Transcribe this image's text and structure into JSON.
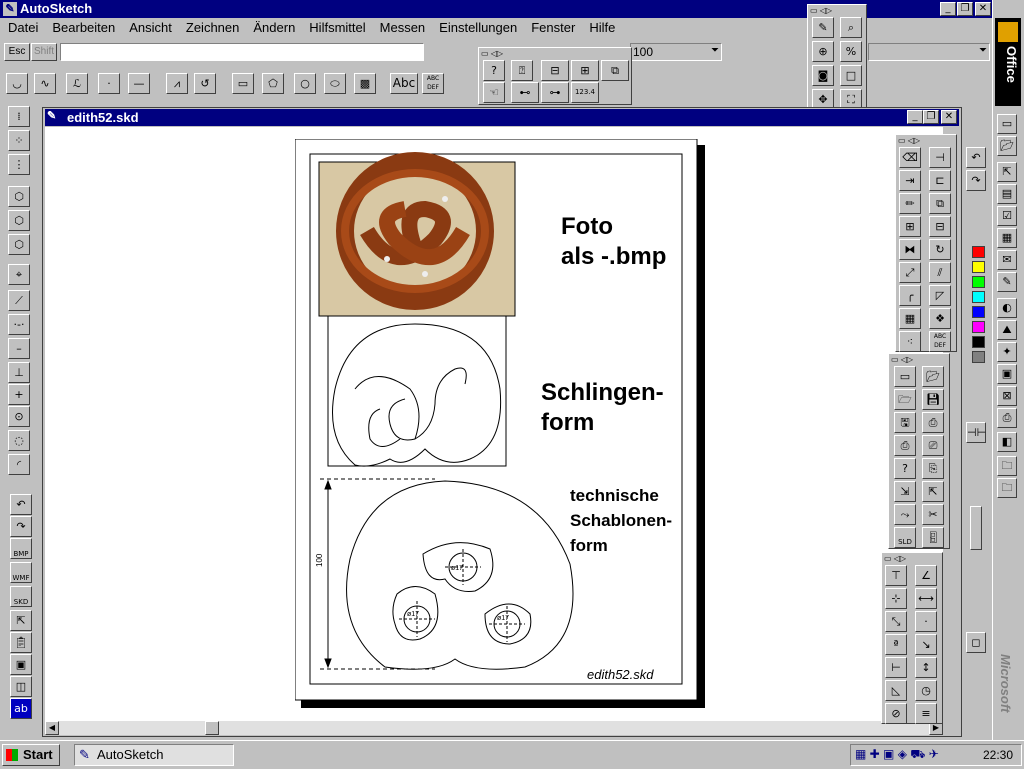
{
  "app": {
    "title": "AutoSketch"
  },
  "menu": [
    "Datei",
    "Bearbeiten",
    "Ansicht",
    "Zeichnen",
    "Ändern",
    "Hilfsmittel",
    "Messen",
    "Einstellungen",
    "Fenster",
    "Hilfe"
  ],
  "toolbar": {
    "esc": "Esc",
    "shift": "Shift",
    "zoom": "100",
    "text_abc": "Abc",
    "abcdef": "ABC DEF"
  },
  "doc": {
    "title": "edith52.skd",
    "foto_line1": "Foto",
    "foto_line2": "als -.bmp",
    "schlingen_line1": "Schlingen-",
    "schlingen_line2": "form",
    "tech_line1": "technische",
    "tech_line2": "Schablonen-",
    "tech_line3": "form",
    "dim": "100",
    "circle_label": "ø17",
    "filename": "edith52.skd"
  },
  "left_toolbar": {
    "bmp": "BMP",
    "wmf": "WMF",
    "skd": "SKD",
    "abc": "ab",
    "sld": "SLD"
  },
  "office_bar": {
    "title": "Office",
    "brand": "Microsoft"
  },
  "taskbar": {
    "start": "Start",
    "task": "AutoSketch",
    "time": "22:30",
    "num": "123.4"
  },
  "colors": {
    "titlebar": "#000080",
    "face": "#c0c0c0",
    "palette": [
      "#ff0000",
      "#ffff00",
      "#00ff00",
      "#00ffff",
      "#0000ff",
      "#ff00ff",
      "#000000",
      "#808080"
    ]
  }
}
